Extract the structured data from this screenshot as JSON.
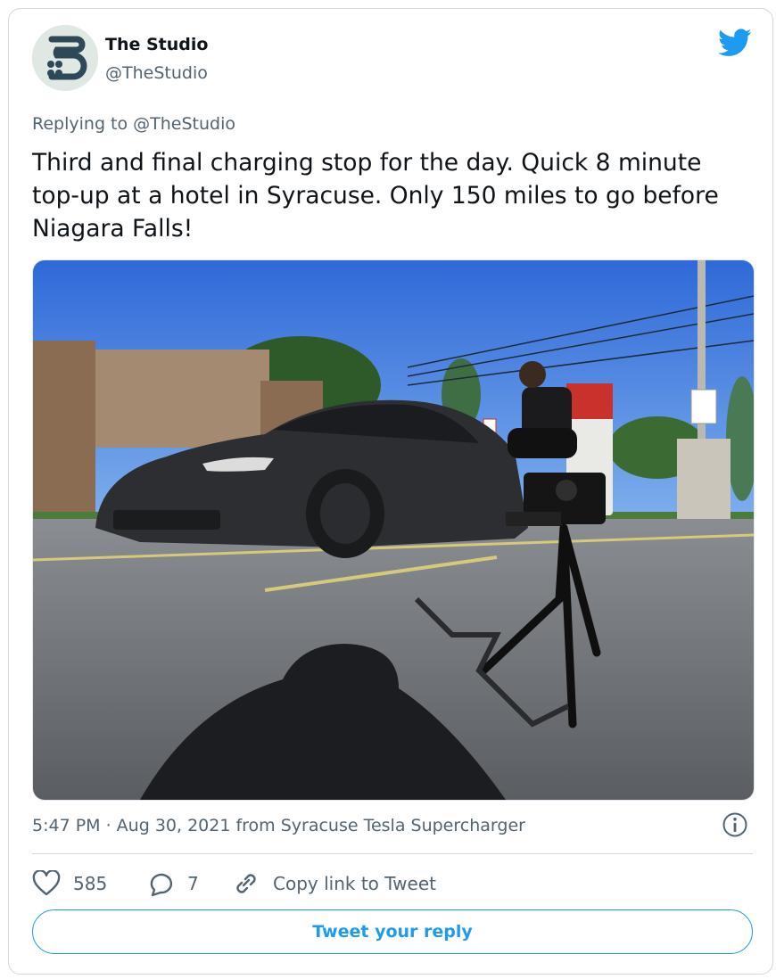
{
  "author": {
    "name": "The Studio",
    "handle": "@TheStudio",
    "avatar_icon": "studio-s-logo",
    "avatar_bg": "#dfe8e3",
    "avatar_fg": "#2f4858"
  },
  "brand": {
    "icon": "twitter-bird",
    "color": "#1d9bf0"
  },
  "tweet": {
    "replying_to": "Replying to @TheStudio",
    "text": "Third and final charging stop for the day. Quick 8 minute\ntop-up at a hotel in Syracuse. Only 150 miles to go before\nNiagara Falls!",
    "timestamp": "5:47 PM · Aug 30, 2021 from Syracuse Tesla Supercharger",
    "photo_icon": "photo-tesla-at-supercharger"
  },
  "actions": {
    "likes": "585",
    "replies": "7",
    "copy_link": "Copy link to Tweet",
    "info_icon": "info-icon"
  },
  "reply_button": "Tweet your reply"
}
